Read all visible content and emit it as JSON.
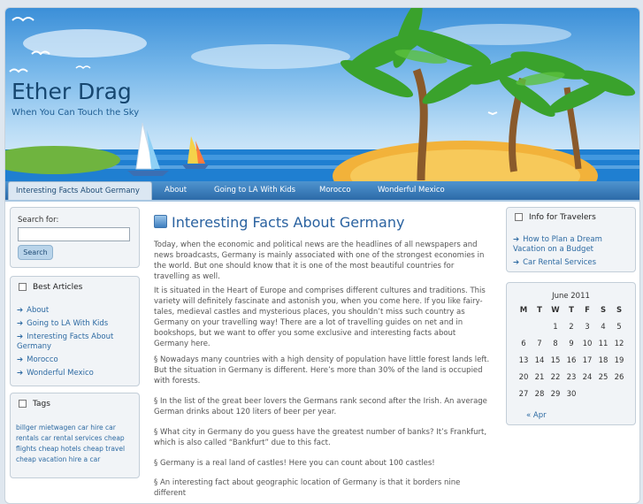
{
  "site": {
    "title": "Ether Drag",
    "tagline": "When You Can Touch the Sky"
  },
  "nav": {
    "items": [
      {
        "label": "Interesting Facts About Germany",
        "active": true
      },
      {
        "label": "About"
      },
      {
        "label": "Going to LA With Kids"
      },
      {
        "label": "Morocco"
      },
      {
        "label": "Wonderful Mexico"
      }
    ]
  },
  "search": {
    "label": "Search for:",
    "placeholder": "",
    "button": "Search"
  },
  "best_articles": {
    "title": "Best Articles",
    "items": [
      "About",
      "Going to LA With Kids",
      "Interesting Facts About Germany",
      "Morocco",
      "Wonderful Mexico"
    ]
  },
  "tags": {
    "title": "Tags",
    "lines": [
      "billger mietwagen car hire car",
      "rentals car rental services cheap",
      "flights cheap hotels cheap travel",
      "cheap vacation hire a car"
    ]
  },
  "post": {
    "title": "Interesting Facts About Germany",
    "paragraphs": [
      "Today, when the economic and political news are the headlines of all newspapers and news broadcasts, Germany is mainly associated with one of the strongest economies in the world. But one should know that it is one of the most beautiful countries for travelling as well.",
      "It is situated in the Heart of Europe and comprises different cultures and traditions. This variety will definitely fascinate and astonish you, when you come here. If you like fairy-tales, medieval castles and mysterious places, you shouldn’t miss such country as Germany on your travelling way! There are a lot of travelling guides on net and in bookshops, but we want to offer you some exclusive and interesting facts about Germany here.",
      "§  Nowadays many countries with a high density of population have little forest lands left. But the situation in Germany is different. Here’s more than 30% of the land is occupied with forests.",
      "§  In the list of the great beer lovers the Germans rank second after the Irish. An average German drinks about 120 liters of beer per year.",
      "§  What city in Germany do you guess have the greatest number of banks? It’s Frankfurt, which is also called “Bankfurt” due to this fact.",
      "§  Germany is a real land of castles! Here you can count about 100 castles!",
      "§  An interesting fact about geographic location of Germany is that it borders nine different"
    ]
  },
  "info": {
    "title": "Info for Travelers",
    "items": [
      "How to Plan a Dream Vacation on a Budget",
      "Car Rental Services"
    ]
  },
  "calendar": {
    "month": "June 2011",
    "days": [
      "M",
      "T",
      "W",
      "T",
      "F",
      "S",
      "S"
    ],
    "weeks": [
      [
        "",
        "",
        "1",
        "2",
        "3",
        "4",
        "5"
      ],
      [
        "6",
        "7",
        "8",
        "9",
        "10",
        "11",
        "12"
      ],
      [
        "13",
        "14",
        "15",
        "16",
        "17",
        "18",
        "19"
      ],
      [
        "20",
        "21",
        "22",
        "23",
        "24",
        "25",
        "26"
      ],
      [
        "27",
        "28",
        "29",
        "30",
        "",
        "",
        ""
      ]
    ],
    "prev": "« Apr"
  }
}
